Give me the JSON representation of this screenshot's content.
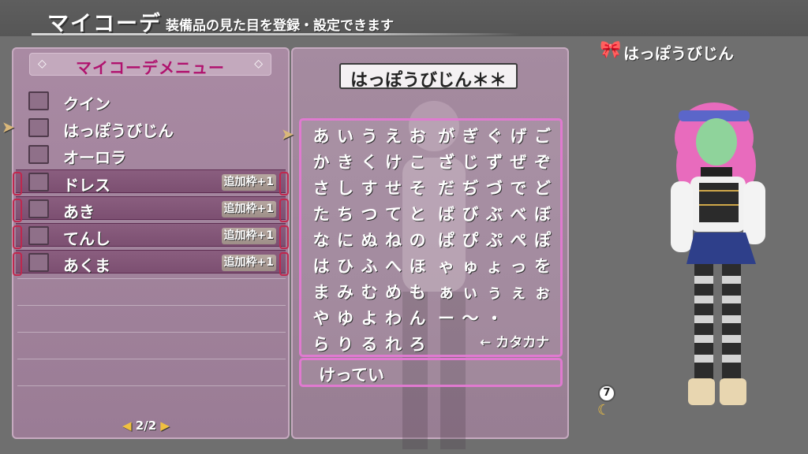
{
  "header": {
    "title": "マイコーデ",
    "description": "装備品の見た目を登録・設定できます"
  },
  "menu": {
    "title": "マイコーデメニュー",
    "items": [
      {
        "label": "クイン",
        "badge": ""
      },
      {
        "label": "はっぽうびじん",
        "badge": ""
      },
      {
        "label": "オーロラ",
        "badge": ""
      },
      {
        "label": "ドレス",
        "badge": "追加枠+1"
      },
      {
        "label": "あき",
        "badge": "追加枠+1"
      },
      {
        "label": "てんし",
        "badge": "追加枠+1"
      },
      {
        "label": "あくま",
        "badge": "追加枠+1"
      }
    ],
    "selected_index": 1,
    "pager": "2/2"
  },
  "name_input": {
    "value": "はっぽうびじん＊＊"
  },
  "kana": {
    "rows": [
      [
        "あ",
        "い",
        "う",
        "え",
        "お",
        "が",
        "ぎ",
        "ぐ",
        "げ",
        "ご"
      ],
      [
        "か",
        "き",
        "く",
        "け",
        "こ",
        "ざ",
        "じ",
        "ず",
        "ぜ",
        "ぞ"
      ],
      [
        "さ",
        "し",
        "す",
        "せ",
        "そ",
        "だ",
        "ぢ",
        "づ",
        "で",
        "ど"
      ],
      [
        "た",
        "ち",
        "つ",
        "て",
        "と",
        "ば",
        "び",
        "ぶ",
        "べ",
        "ぼ"
      ],
      [
        "な",
        "に",
        "ぬ",
        "ね",
        "の",
        "ぱ",
        "ぴ",
        "ぷ",
        "ぺ",
        "ぽ"
      ],
      [
        "は",
        "ひ",
        "ふ",
        "へ",
        "ほ",
        "ゃ",
        "ゅ",
        "ょ",
        "っ",
        "を"
      ],
      [
        "ま",
        "み",
        "む",
        "め",
        "も",
        "ぁ",
        "ぃ",
        "ぅ",
        "ぇ",
        "ぉ"
      ],
      [
        "や",
        "ゆ",
        "よ",
        "わ",
        "ん",
        "ー",
        "～",
        "・",
        "",
        ""
      ],
      [
        "ら",
        "り",
        "る",
        "れ",
        "ろ",
        "",
        "",
        "",
        "",
        ""
      ]
    ],
    "katakana_toggle": "← カタカナ",
    "confirm": "けってい"
  },
  "preview": {
    "name": "はっぽうびじん",
    "time_badge": "7"
  },
  "colors": {
    "accent_pink": "#e07ad0",
    "menu_title": "#b0126e",
    "panel": "#a98aa3"
  },
  "icons": [
    "ribbon-icon",
    "pointer-hand-icon",
    "clock-icon",
    "moon-icon"
  ]
}
